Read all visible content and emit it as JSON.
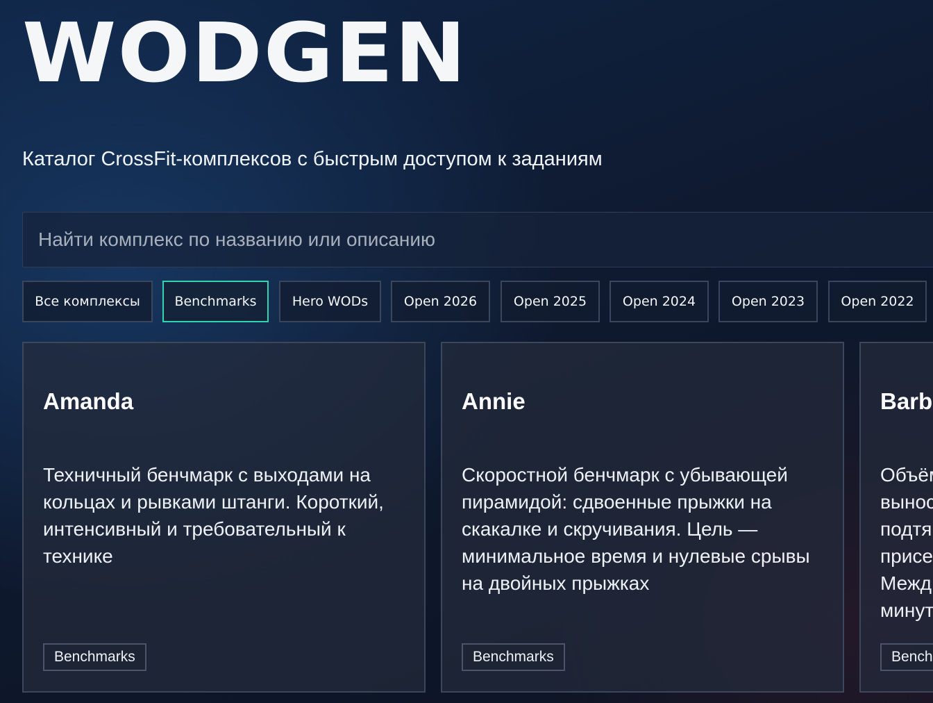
{
  "header": {
    "logo": "WODGEN",
    "subtitle": "Каталог CrossFit-комплексов с быстрым доступом к заданиям"
  },
  "search": {
    "placeholder": "Найти комплекс по названию или описанию",
    "value": ""
  },
  "filters": [
    {
      "label": "Все комплексы",
      "active": false
    },
    {
      "label": "Benchmarks",
      "active": true
    },
    {
      "label": "Hero WODs",
      "active": false
    },
    {
      "label": "Open 2026",
      "active": false
    },
    {
      "label": "Open 2025",
      "active": false
    },
    {
      "label": "Open 2024",
      "active": false
    },
    {
      "label": "Open 2023",
      "active": false
    },
    {
      "label": "Open 2022",
      "active": false
    }
  ],
  "cards": [
    {
      "title": "Amanda",
      "description": "Техничный бенчмарк с выходами на кольцах и рывками штанги. Короткий, интенсивный и требовательный к технике",
      "tag": "Benchmarks"
    },
    {
      "title": "Annie",
      "description": "Скоростной бенчмарк с убывающей пирамидой: сдвоенные прыжки на скакалке и скручивания. Цель — минимальное время и нулевые срывы на двойных прыжках",
      "tag": "Benchmarks"
    },
    {
      "title": "Barba",
      "description": "Объём выносл подтя присе Межд минут",
      "tag": "Bench"
    }
  ],
  "colors": {
    "accent": "#2fd6b0",
    "background": "#0f1a30",
    "card_border": "#3d475c"
  }
}
